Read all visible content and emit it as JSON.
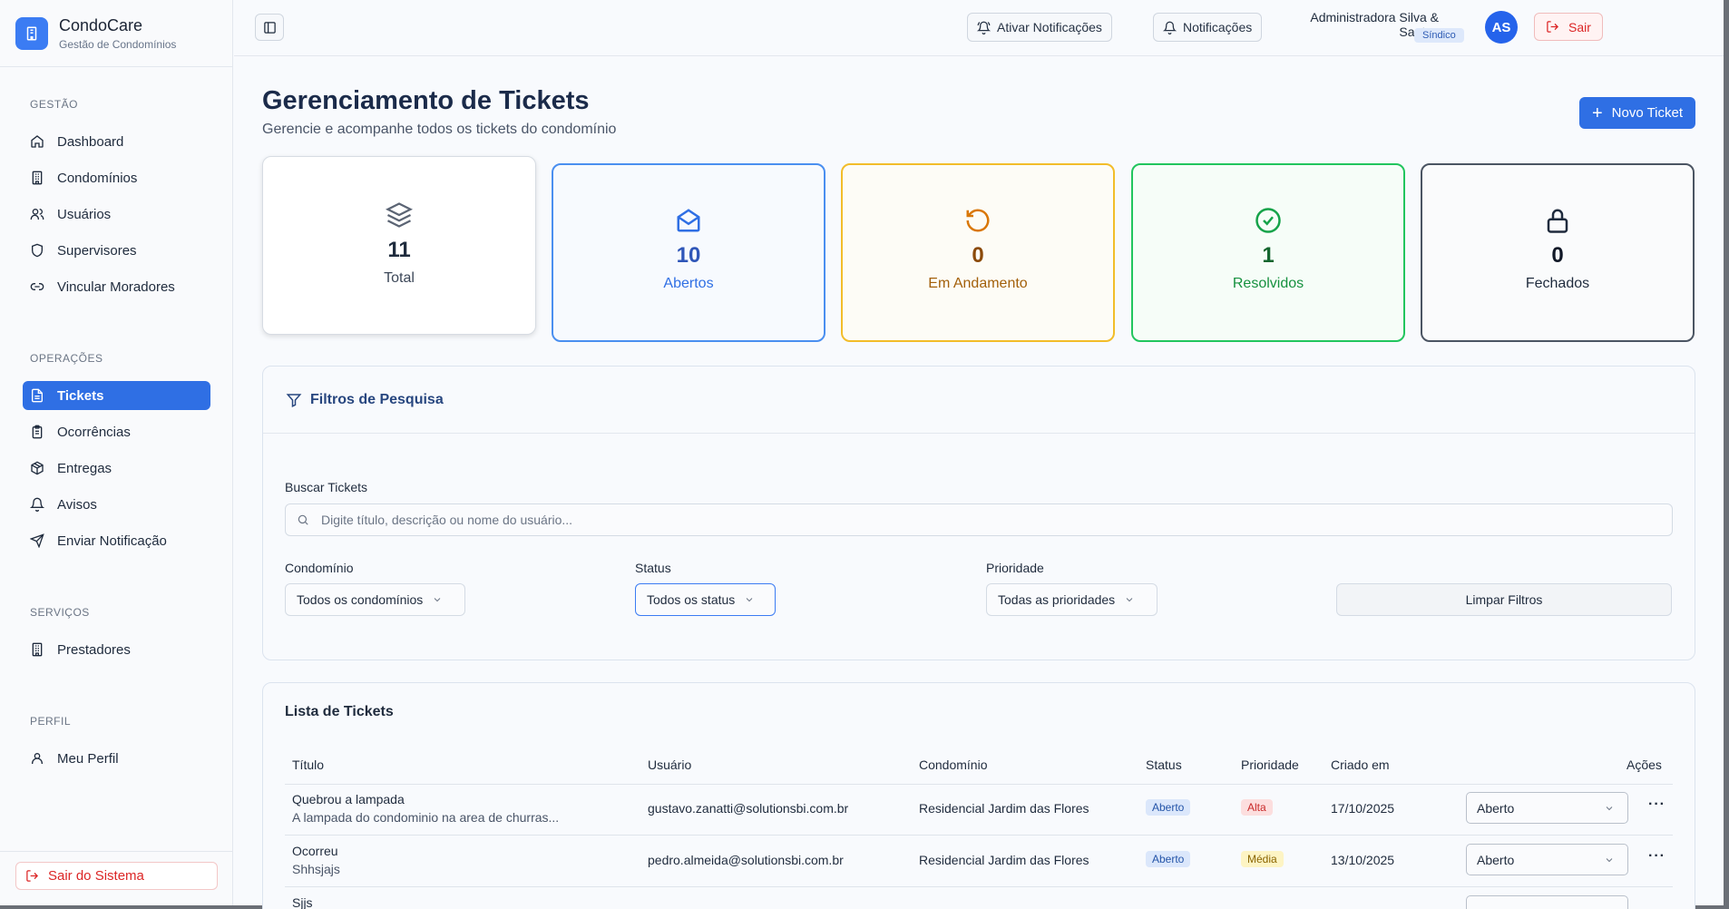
{
  "brand": {
    "name": "CondoCare",
    "subtitle": "Gestão de Condomínios"
  },
  "sidebar": {
    "sections": [
      {
        "heading": "GESTÃO",
        "items": [
          {
            "label": "Dashboard",
            "icon": "home-icon"
          },
          {
            "label": "Condomínios",
            "icon": "building-icon"
          },
          {
            "label": "Usuários",
            "icon": "users-icon"
          },
          {
            "label": "Supervisores",
            "icon": "shield-icon"
          },
          {
            "label": "Vincular Moradores",
            "icon": "link-icon"
          }
        ]
      },
      {
        "heading": "OPERAÇÕES",
        "items": [
          {
            "label": "Tickets",
            "icon": "ticket-icon",
            "active": true
          },
          {
            "label": "Ocorrências",
            "icon": "clipboard-icon"
          },
          {
            "label": "Entregas",
            "icon": "package-icon"
          },
          {
            "label": "Avisos",
            "icon": "bell-icon"
          },
          {
            "label": "Enviar Notificação",
            "icon": "send-icon"
          }
        ]
      },
      {
        "heading": "SERVIÇOS",
        "items": [
          {
            "label": "Prestadores",
            "icon": "building-icon"
          }
        ]
      },
      {
        "heading": "PERFIL",
        "items": [
          {
            "label": "Meu Perfil",
            "icon": "user-icon"
          }
        ]
      }
    ],
    "logout_label": "Sair do Sistema"
  },
  "header": {
    "activate_notifications": "Ativar Notificações",
    "notifications": "Notificações",
    "user_name": "Administradora Silva & Santos",
    "user_role": "Síndico",
    "avatar_initials": "AS",
    "logout": "Sair"
  },
  "page": {
    "title": "Gerenciamento de Tickets",
    "subtitle": "Gerencie e acompanhe todos os tickets do condomínio",
    "new_ticket": "Novo Ticket"
  },
  "stats": [
    {
      "value": "11",
      "label": "Total",
      "icon": "layers-icon",
      "color": "#1f2b3d"
    },
    {
      "value": "10",
      "label": "Abertos",
      "icon": "mail-open-icon",
      "color": "#2f6fe4"
    },
    {
      "value": "0",
      "label": "Em Andamento",
      "icon": "rotate-icon",
      "color": "#c7790a"
    },
    {
      "value": "1",
      "label": "Resolvidos",
      "icon": "check-circle-icon",
      "color": "#16913f"
    },
    {
      "value": "0",
      "label": "Fechados",
      "icon": "lock-icon",
      "color": "#1f2b3d"
    }
  ],
  "filters": {
    "title": "Filtros de Pesquisa",
    "search_label": "Buscar Tickets",
    "search_placeholder": "Digite título, descrição ou nome do usuário...",
    "condominio_label": "Condomínio",
    "condominio_value": "Todos os condomínios",
    "status_label": "Status",
    "status_value": "Todos os status",
    "priority_label": "Prioridade",
    "priority_value": "Todas as prioridades",
    "clear": "Limpar Filtros"
  },
  "list": {
    "title": "Lista de Tickets",
    "columns": [
      "Título",
      "Usuário",
      "Condomínio",
      "Status",
      "Prioridade",
      "Criado em",
      "Ações"
    ],
    "rows": [
      {
        "title": "Quebrou a lampada",
        "desc": "A lampada do condominio na area de churras...",
        "user": "gustavo.zanatti@solutionsbi.com.br",
        "condo": "Residencial Jardim das Flores",
        "status": "Aberto",
        "priority": "Alta",
        "created": "17/10/2025",
        "action_status": "Aberto"
      },
      {
        "title": "Ocorreu",
        "desc": "Shhsjajs",
        "user": "pedro.almeida@solutionsbi.com.br",
        "condo": "Residencial Jardim das Flores",
        "status": "Aberto",
        "priority": "Média",
        "created": "13/10/2025",
        "action_status": "Aberto"
      },
      {
        "title": "Sjjs",
        "desc": "",
        "user": "",
        "condo": "",
        "status": "",
        "priority": "",
        "created": "",
        "action_status": ""
      }
    ]
  }
}
